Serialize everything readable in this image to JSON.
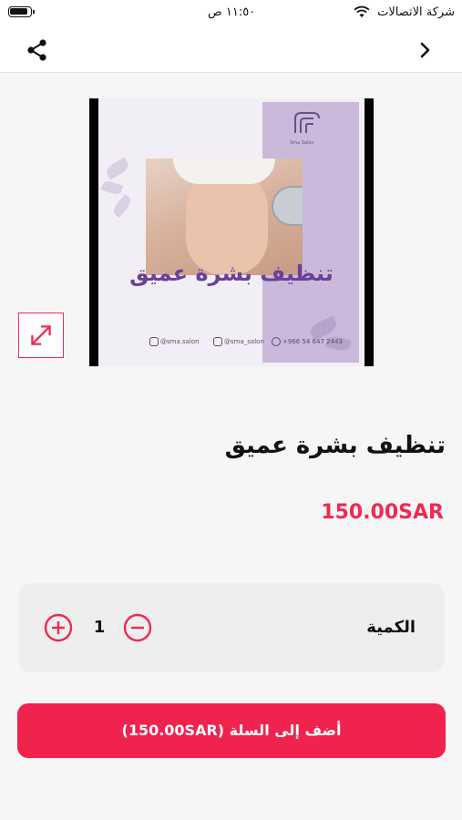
{
  "status_bar": {
    "carrier": "شركة الاتصالات",
    "time": "١١:٥٠ ص",
    "icons": [
      "battery-icon",
      "wifi-icon"
    ]
  },
  "nav": {
    "icons": [
      "share-icon",
      "chevron-right-icon"
    ]
  },
  "product": {
    "image_overlay_title": "تنظيف بشرة عميق",
    "image_brand": "Sma Salon",
    "image_social": {
      "instagram": "@sma.salon",
      "snapchat": "@sma_salon",
      "whatsapp": "+966 54 647 2443"
    },
    "title": "تنظيف بشرة عميق",
    "price": "150.00SAR",
    "expand_icon": "expand-icon"
  },
  "quantity": {
    "label": "الكمية",
    "value": "1",
    "icons": [
      "plus-circle-icon",
      "minus-circle-icon"
    ]
  },
  "cart_button": {
    "label": "أضف إلى السلة (150.00SAR)"
  },
  "colors": {
    "accent": "#f0224e",
    "image_panel": "#cbb9dc",
    "image_text": "#6b3f9c"
  }
}
